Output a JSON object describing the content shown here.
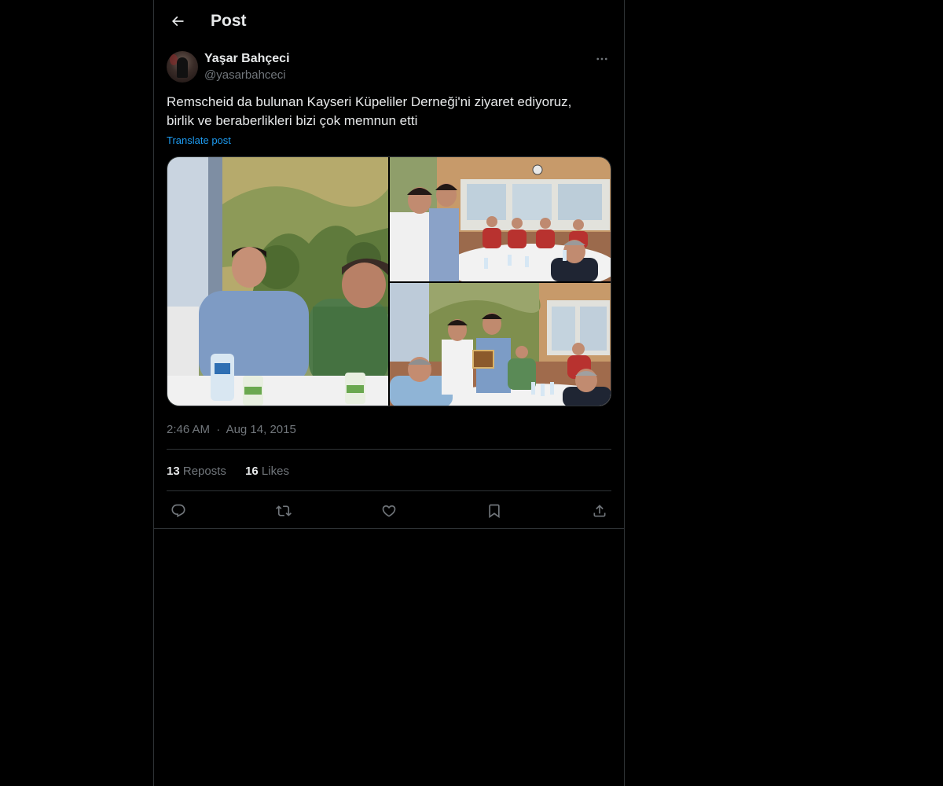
{
  "header": {
    "title": "Post",
    "back_icon": "arrow-left-icon"
  },
  "post": {
    "author_name": "Yaşar Bahçeci",
    "author_handle": "@yasarbahceci",
    "text": "Remscheid da bulunan Kayseri Küpeliler Derneği'ni ziyaret ediyoruz,\nbirlik ve beraberlikleri bizi çok memnun etti",
    "translate_label": "Translate post",
    "time": "2:46 AM",
    "separator": "·",
    "date": "Aug 14, 2015",
    "media": [
      "photo-1",
      "photo-2",
      "photo-3"
    ],
    "more_icon": "more-horizontal-icon"
  },
  "stats": {
    "reposts_count": "13",
    "reposts_label": "Reposts",
    "likes_count": "16",
    "likes_label": "Likes"
  },
  "actions": {
    "icons": [
      "reply-icon",
      "repost-icon",
      "like-icon",
      "bookmark-icon",
      "share-icon"
    ]
  },
  "colors": {
    "background": "#000000",
    "text_primary": "#e7e9ea",
    "text_secondary": "#71767b",
    "link": "#1d9bf0",
    "border": "#2f3336"
  }
}
